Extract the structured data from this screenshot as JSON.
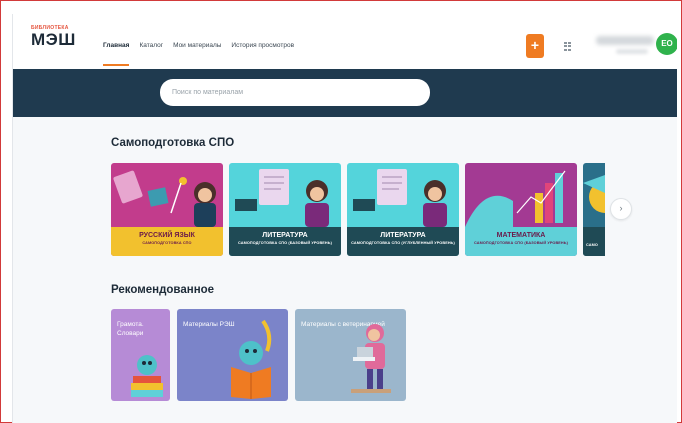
{
  "header": {
    "logo_small": "БИБЛИОТЕКА",
    "logo_big": "МЭШ",
    "nav": [
      "Главная",
      "Каталог",
      "Мои материалы",
      "История просмотров"
    ],
    "plus_label": "+",
    "avatar_initials": "ЕО",
    "icons": {
      "add": "plus-icon",
      "apps": "grid-icon"
    }
  },
  "search": {
    "placeholder": "Поиск по материалам"
  },
  "spo": {
    "title": "Самоподготовка СПО",
    "cards": [
      {
        "title": "РУССКИЙ ЯЗЫК",
        "subtitle": "САМОПОДГОТОВКА СПО",
        "bg": "#c23c8c",
        "label_bg": "#f2c12e"
      },
      {
        "title": "ЛИТЕРАТУРА",
        "subtitle": "САМОПОДГОТОВКА СПО (БАЗОВЫЙ УРОВЕНЬ)",
        "bg": "#54d4db",
        "label_bg": "#1f4a55"
      },
      {
        "title": "ЛИТЕРАТУРА",
        "subtitle": "САМОПОДГОТОВКА СПО (УГЛУБЛЕННЫЙ УРОВЕНЬ)",
        "bg": "#54d4db",
        "label_bg": "#1f4a55"
      },
      {
        "title": "МАТЕМАТИКА",
        "subtitle": "САМОПОДГОТОВКА СПО (БАЗОВЫЙ УРОВЕНЬ)",
        "bg": "#a33a93",
        "label_bg": "#5fd0d8"
      },
      {
        "title": "",
        "subtitle": "САМО",
        "bg": "#2a6f8a",
        "label_bg": "#1f4a55"
      }
    ],
    "next_icon": "chevron-right-icon"
  },
  "recommended": {
    "title": "Рекомендованное",
    "cards": [
      {
        "title": "Грамота. Словари",
        "bg": "#b68bd6"
      },
      {
        "title": "Материалы РЭШ",
        "bg": "#7b84c9"
      },
      {
        "title": "Материалы с ветеринарией",
        "bg": "#9bb6cc"
      }
    ]
  }
}
